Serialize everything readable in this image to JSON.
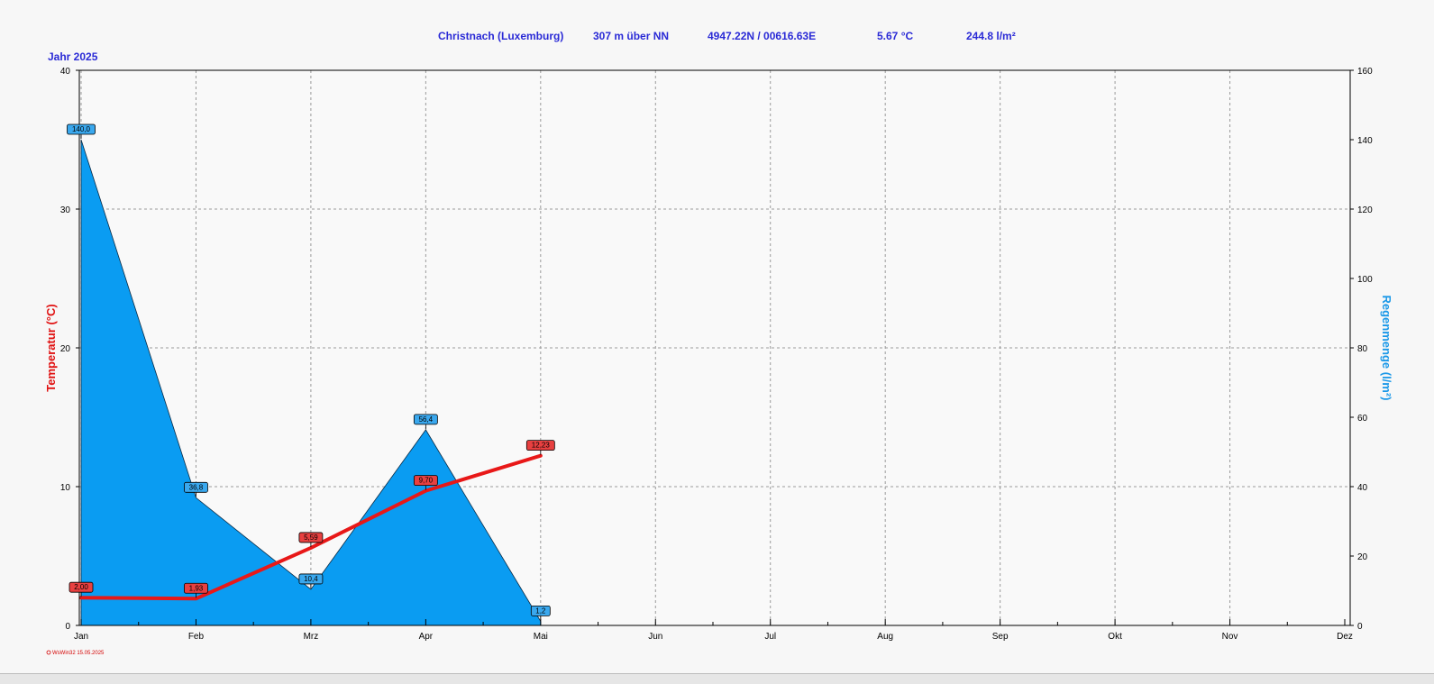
{
  "header": {
    "station": "Christnach (Luxemburg)",
    "elevation": "307 m über NN",
    "coords": "4947.22N / 00616.63E",
    "avg_temp": "5.67 °C",
    "total_rain": "244.8 l/m²",
    "year_label": "Jahr  2025"
  },
  "credit": "WsWin32  15.05.2025",
  "colors": {
    "temperature": "#e81818",
    "rain_fill": "#0a9cf2",
    "temp_label_bg": "#e84040",
    "rain_label_bg": "#3aa8ee",
    "header_text": "#2a2ad6"
  },
  "chart_data": {
    "type": "line",
    "categories": [
      "Jan",
      "Feb",
      "Mrz",
      "Apr",
      "Mai",
      "Jun",
      "Jul",
      "Aug",
      "Sep",
      "Okt",
      "Nov",
      "Dez"
    ],
    "series": [
      {
        "name": "Temperatur",
        "kind": "line",
        "axis": "left",
        "values": [
          2.0,
          1.93,
          5.59,
          9.7,
          12.23
        ],
        "labels": [
          "2,00",
          "1,93",
          "5,59",
          "9,70",
          "12,23"
        ]
      },
      {
        "name": "Regenmenge",
        "kind": "area",
        "axis": "right",
        "values": [
          140.0,
          36.8,
          10.4,
          56.4,
          1.2
        ],
        "labels": [
          "140,0",
          "36,8",
          "10,4",
          "56,4",
          "1,2"
        ]
      }
    ],
    "ylabel": "Temperatur  (°C)",
    "ylim": [
      0,
      40
    ],
    "yticks": [
      0,
      10,
      20,
      30,
      40
    ],
    "y2label": "Regenmenge  (l/m²)",
    "y2lim": [
      0,
      160
    ],
    "y2ticks": [
      0,
      20,
      40,
      60,
      80,
      100,
      120,
      140,
      160
    ],
    "grid": true
  }
}
